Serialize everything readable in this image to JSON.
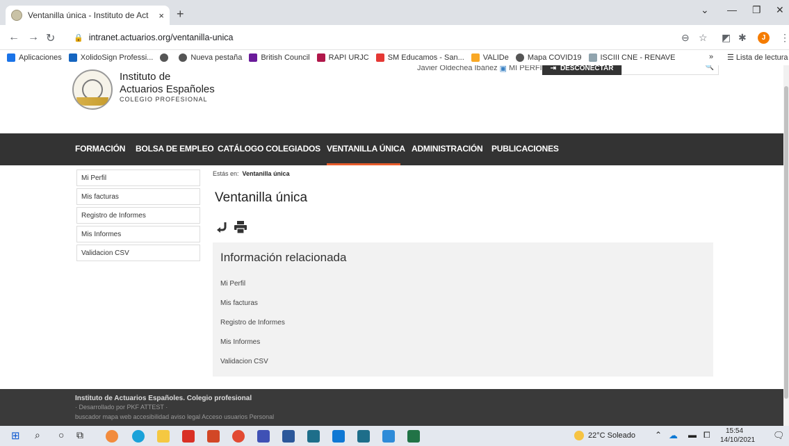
{
  "browser": {
    "tab_title": "Ventanilla única - Instituto de Act",
    "tab_close": "×",
    "new_tab": "+",
    "url": "intranet.actuarios.org/ventanilla-unica",
    "avatar_letter": "J",
    "bookmarks": [
      {
        "label": "Aplicaciones",
        "color": "#1a73e8"
      },
      {
        "label": "XolidoSign Professi...",
        "color": "#1565c0"
      },
      {
        "label": "",
        "color": "#555555"
      },
      {
        "label": "Nueva pestaña",
        "color": "#555555"
      },
      {
        "label": "British Council",
        "color": "#6a1b9a"
      },
      {
        "label": "RAPI URJC",
        "color": "#b0174a"
      },
      {
        "label": "SM Educamos - San...",
        "color": "#e53935"
      },
      {
        "label": "VALIDe",
        "color": "#f9a825"
      },
      {
        "label": "Mapa COVID19",
        "color": "#555555"
      },
      {
        "label": "ISCIII CNE - RENAVE",
        "color": "#90a4ae"
      }
    ],
    "bookmarks_more": "»",
    "reading_list": "Lista de lectura"
  },
  "site": {
    "brand_line1": "Instituto de",
    "brand_line2": "Actuarios Españoles",
    "brand_line3": "COLEGIO PROFESIONAL",
    "user_name": "Javier Oldechea Ibáñez",
    "my_profile": "MI PERFIL",
    "disconnect": "DESCONECTAR",
    "nav": [
      {
        "label": "FORMACIÓN"
      },
      {
        "label": "BOLSA DE EMPLEO"
      },
      {
        "label": "CATÁLOGO COLEGIADOS"
      },
      {
        "label": "VENTANILLA ÚNICA"
      },
      {
        "label": "ADMINISTRACIÓN"
      },
      {
        "label": "PUBLICACIONES"
      }
    ],
    "active_nav": "VENTANILLA ÚNICA",
    "sidebar": [
      "Mi Perfil",
      "Mis facturas",
      "Registro de Informes",
      "Mis Informes",
      "Validacion CSV"
    ],
    "breadcrumb_prefix": "Estás en:",
    "breadcrumb_current": "Ventanilla única",
    "page_title": "Ventanilla única",
    "related_title": "Información relacionada",
    "related_links": [
      "Mi Perfil",
      "Mis facturas",
      "Registro de Informes",
      "Mis Informes",
      "Validacion CSV"
    ],
    "footer_line1": "Instituto de Actuarios Españoles. Colegio profesional",
    "footer_line2": "· Desarrollado por  PKF ATTEST ·",
    "footer_line3": "buscador  mapa web  accesibilidad  aviso legal  Acceso usuarios  Personal",
    "accent_color": "#e85c2b"
  },
  "taskbar": {
    "weather": "22°C  Soleado",
    "time": "15:54",
    "date": "14/10/2021"
  }
}
